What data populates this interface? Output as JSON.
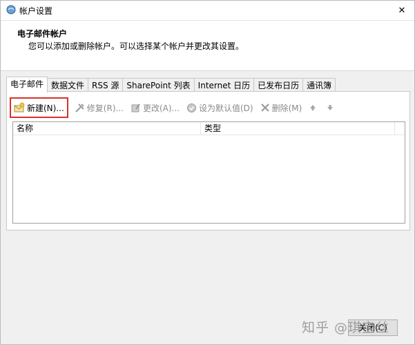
{
  "window": {
    "title": "帐户设置",
    "close_glyph": "✕"
  },
  "header": {
    "title": "电子邮件帐户",
    "description": "您可以添加或删除帐户。可以选择某个帐户并更改其设置。"
  },
  "tabs": [
    {
      "label": "电子邮件",
      "active": true
    },
    {
      "label": "数据文件"
    },
    {
      "label": "RSS 源"
    },
    {
      "label": "SharePoint 列表"
    },
    {
      "label": "Internet 日历"
    },
    {
      "label": "已发布日历"
    },
    {
      "label": "通讯簿"
    }
  ],
  "toolbar": {
    "new_label": "新建(N)...",
    "repair_label": "修复(R)...",
    "change_label": "更改(A)...",
    "default_label": "设为默认值(D)",
    "remove_label": "删除(M)",
    "new_icon": "envelope-new-icon",
    "repair_icon": "tools-icon",
    "change_icon": "edit-icon",
    "default_icon": "check-circle-icon",
    "remove_icon": "x-icon",
    "up_icon": "arrow-up-icon",
    "down_icon": "arrow-down-icon"
  },
  "list": {
    "col_name": "名称",
    "col_type": "类型"
  },
  "footer": {
    "close_label": "关闭(C)",
    "watermark": "知乎 @琪宝丝"
  },
  "colors": {
    "highlight": "#d9302b",
    "disabled_text": "#8a8a8a"
  }
}
